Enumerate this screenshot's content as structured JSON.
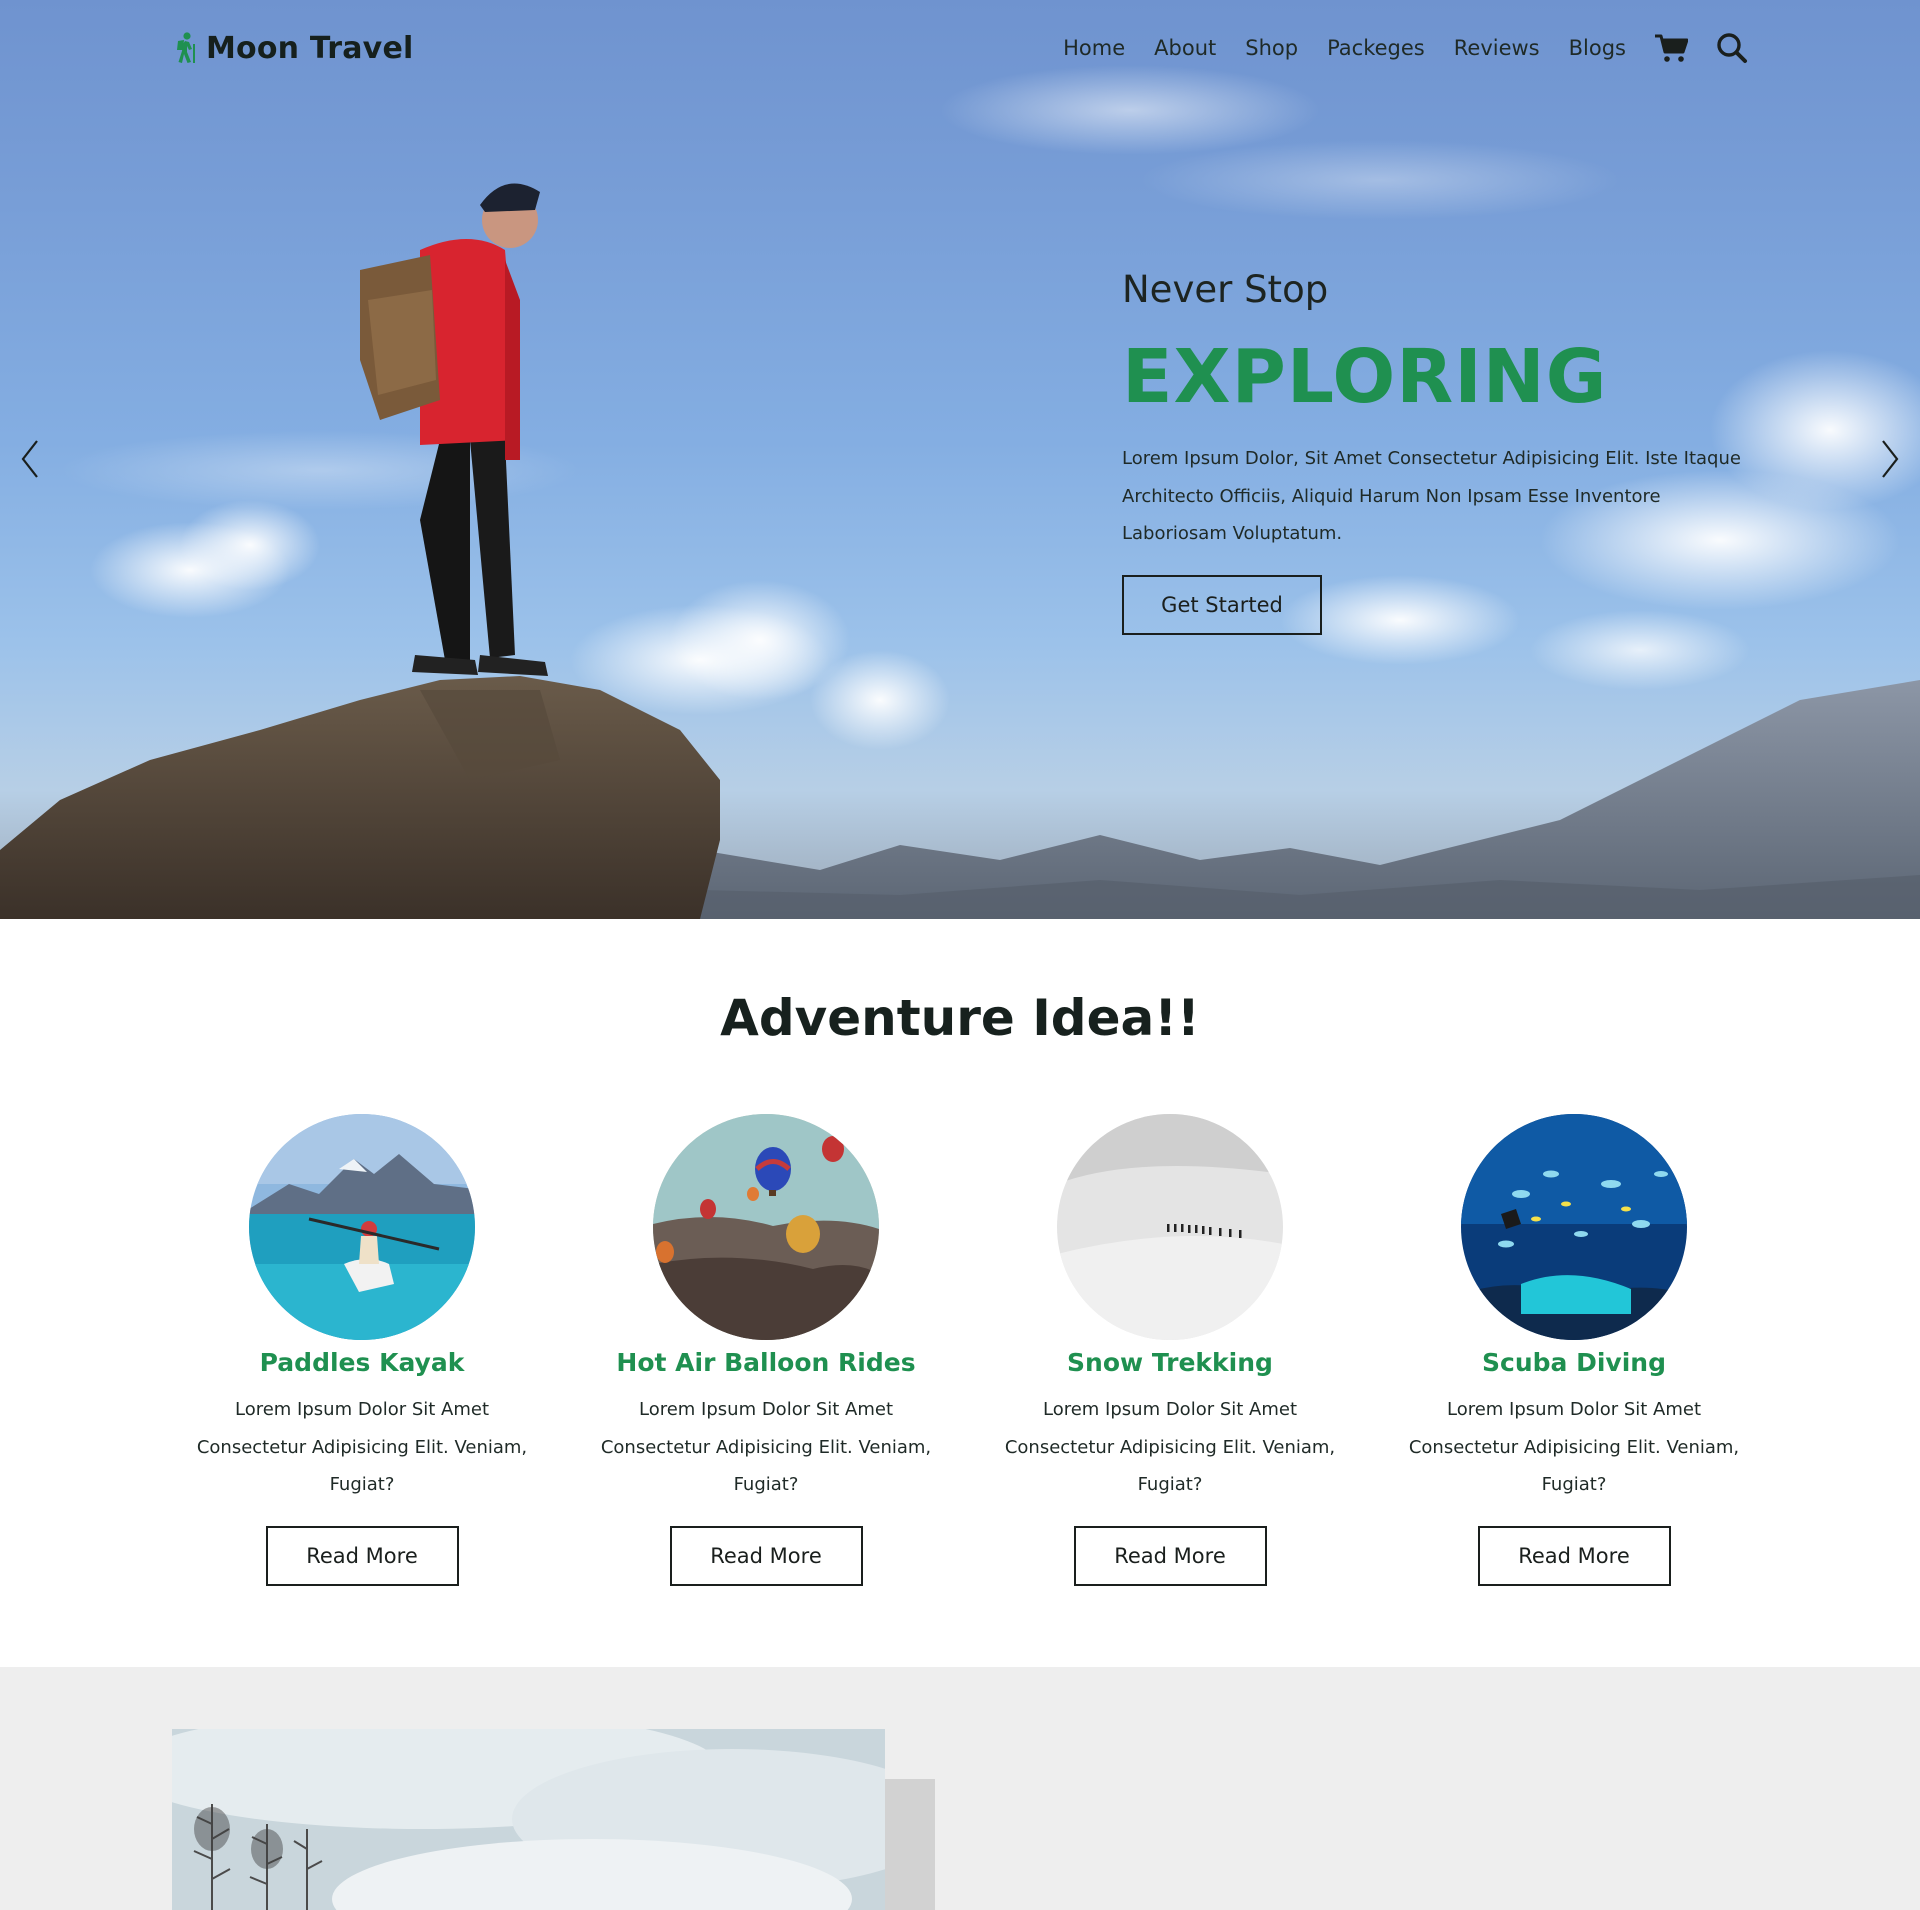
{
  "brand": {
    "name": "Moon Travel",
    "logo_icon": "hiker-icon",
    "accent_color": "#1f9050"
  },
  "nav": {
    "links": [
      "Home",
      "About",
      "Shop",
      "Packeges",
      "Reviews",
      "Blogs"
    ],
    "icons": [
      "cart-icon",
      "search-icon"
    ]
  },
  "hero": {
    "kicker": "Never Stop",
    "title": "EXPLORING",
    "text": "Lorem Ipsum Dolor, Sit Amet Consectetur Adipisicing Elit. Iste Itaque Architecto Officiis, Aliquid Harum Non Ipsam Esse Inventore Laboriosam Voluptatum.",
    "button": "Get Started",
    "prev_icon": "chevron-left-icon",
    "next_icon": "chevron-right-icon"
  },
  "adventure": {
    "title": "Adventure Idea!!",
    "cards": [
      {
        "title": "Paddles Kayak",
        "text": "Lorem Ipsum Dolor Sit Amet Consectetur Adipisicing Elit. Veniam, Fugiat?",
        "button": "Read More"
      },
      {
        "title": "Hot Air Balloon Rides",
        "text": "Lorem Ipsum Dolor Sit Amet Consectetur Adipisicing Elit. Veniam, Fugiat?",
        "button": "Read More"
      },
      {
        "title": "Snow Trekking",
        "text": "Lorem Ipsum Dolor Sit Amet Consectetur Adipisicing Elit. Veniam, Fugiat?",
        "button": "Read More"
      },
      {
        "title": "Scuba Diving",
        "text": "Lorem Ipsum Dolor Sit Amet Consectetur Adipisicing Elit. Veniam, Fugiat?",
        "button": "Read More"
      }
    ]
  }
}
